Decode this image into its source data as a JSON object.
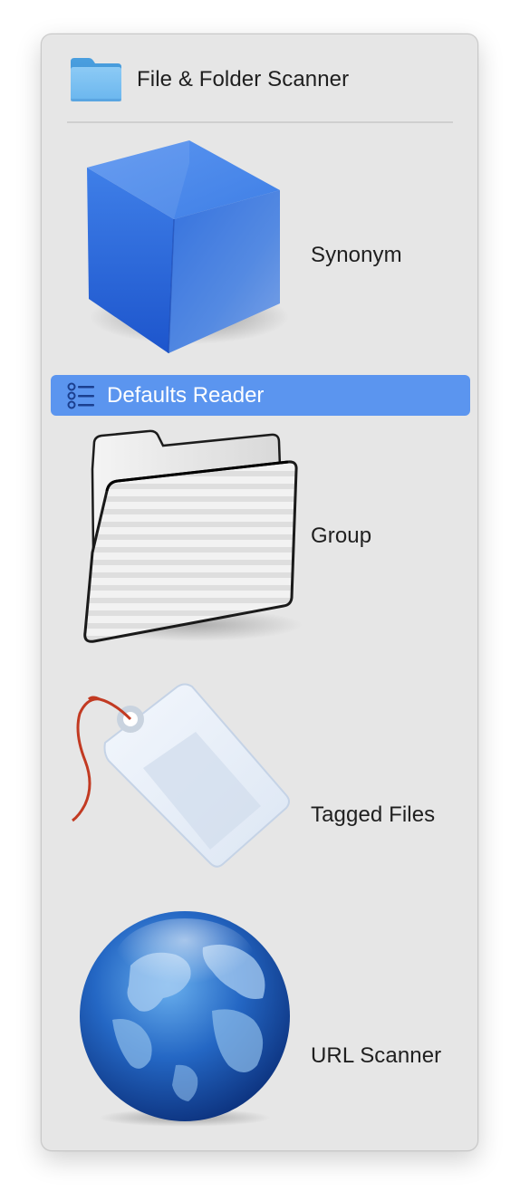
{
  "menu": {
    "header": {
      "label": "File & Folder Scanner",
      "icon": "folder-icon",
      "icon_color": "#5aa9e6"
    },
    "items": [
      {
        "label": "Synonym",
        "icon": "blue-cube-icon",
        "highlighted": false
      },
      {
        "label": "Defaults Reader",
        "icon": "list-icon",
        "highlighted": true
      },
      {
        "label": "Group",
        "icon": "white-folder-icon",
        "highlighted": false
      },
      {
        "label": "Tagged Files",
        "icon": "tag-icon",
        "highlighted": false
      },
      {
        "label": "URL Scanner",
        "icon": "globe-icon",
        "highlighted": false
      }
    ],
    "highlight_color": "#5b95ef"
  }
}
